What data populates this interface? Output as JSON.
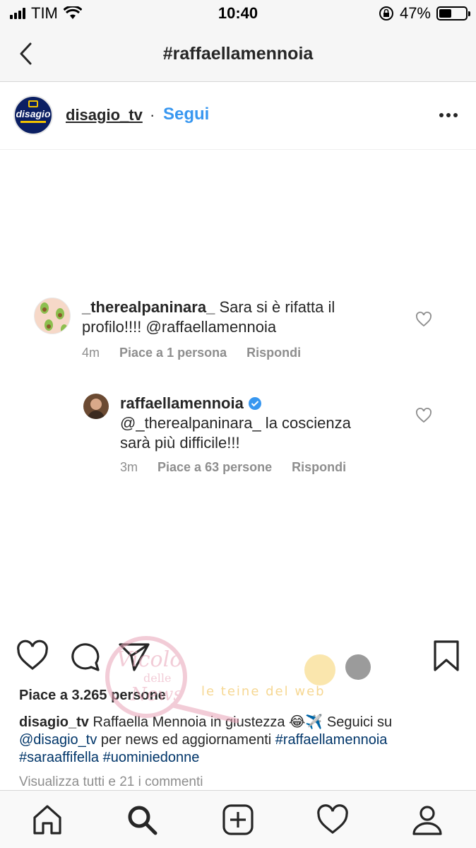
{
  "status_bar": {
    "carrier": "TIM",
    "time": "10:40",
    "battery": "47%",
    "battery_level": 0.47
  },
  "header": {
    "title": "#raffaellamennoia"
  },
  "post": {
    "username": "disagio_tv",
    "separator": "·",
    "follow_label": "Segui",
    "avatar_text": "disagio"
  },
  "comments": [
    {
      "username": "_therealpaninara_",
      "text_line1": "Sara si è rifatta il",
      "text_line2": "profilo!!!! @raffaellamennoia",
      "time": "4m",
      "likes": "Piace a 1 persona",
      "reply": "Rispondi"
    },
    {
      "username": "raffaellamennoia",
      "text_line1": "@_therealpaninara_ la coscienza",
      "text_line2": "sarà più difficile!!!",
      "time": "3m",
      "likes": "Piace a 63 persone",
      "reply": "Rispondi",
      "verified": true
    }
  ],
  "likes_text": "Piace a 3.265 persone",
  "caption": {
    "username": "disagio_tv",
    "text_part1": " Raffaella Mennoia in giustezza 😂✈️ Seguici su",
    "mention": "@disagio_tv",
    "text_part2": " per news ed aggiornamenti ",
    "hashtag1": "#raffaellamennoia",
    "hashtag2": "#saraaffifella",
    "hashtag3": "#uominiedonne"
  },
  "view_all_comments": "Visualizza tutti e 21 i commenti",
  "watermark": {
    "line1": "Vicolo",
    "line2": "delle",
    "line3": "News",
    "line4": "le teine del web"
  },
  "icons": {
    "back": "chevron-left-icon",
    "more": "more-dots-icon",
    "like": "heart-icon",
    "comment": "comment-icon",
    "share": "paper-plane-icon",
    "save": "bookmark-icon",
    "home": "home-icon",
    "search": "search-icon",
    "add": "add-post-icon",
    "activity": "heart-icon",
    "profile": "profile-icon"
  }
}
